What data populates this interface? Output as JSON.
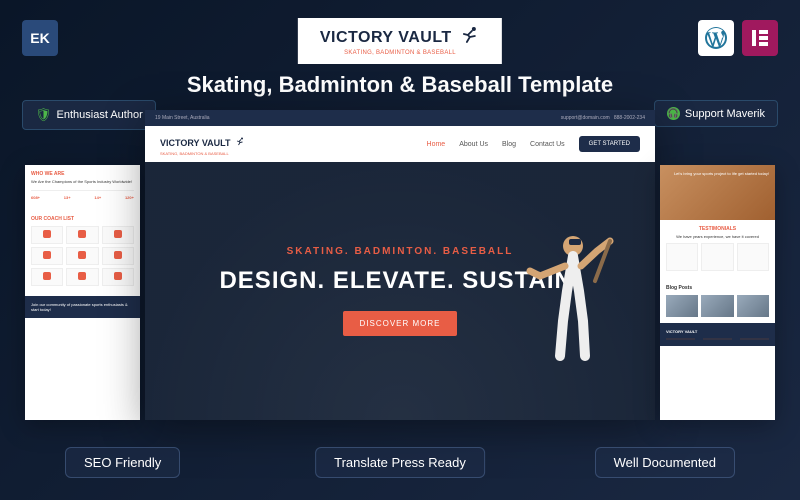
{
  "logo": {
    "title": "VICTORY VAULT",
    "subtitle": "SKATING, BADMINTON & BASEBALL"
  },
  "main_title": "Skating, Badminton & Baseball Template",
  "badges": {
    "tl_label": "EK",
    "author": "Enthusiast Author",
    "support": "Support Maverik"
  },
  "hero": {
    "topbar_left": "19 Main Street, Australia",
    "topbar_email": "support@domain.com",
    "topbar_phone": "888-2002-234",
    "nav_logo": "VICTORY VAULT",
    "nav_logo_sub": "SKATING, BADMINTON & BASEBALL",
    "nav": {
      "home": "Home",
      "about": "About Us",
      "blog": "Blog",
      "contact": "Contact Us",
      "cta": "GET STARTED"
    },
    "tagline": "SKATING. BADMINTON. BASEBALL",
    "headline": "DESIGN. ELEVATE. SUSTAIN.",
    "cta": "DISCOVER MORE"
  },
  "side_left": {
    "who_heading": "WHO WE ARE",
    "who_title": "We Are the Champions of the Sports Industry Worldwide!",
    "stats": [
      "608+",
      "13+",
      "14+",
      "120+"
    ],
    "coach_heading": "OUR COACH LIST",
    "cta_text": "Join our community of passionate sports enthusiasts & start today!"
  },
  "side_right": {
    "hero_text": "Let's bring your sports project to life get started today!",
    "test_heading": "TESTIMONIALS",
    "test_sub": "We have years experience, we have it covered",
    "blog_heading": "Blog Posts",
    "footer_logo": "VICTORY VAULT"
  },
  "pills": {
    "seo": "SEO Friendly",
    "translate": "Translate Press Ready",
    "docs": "Well Documented"
  }
}
